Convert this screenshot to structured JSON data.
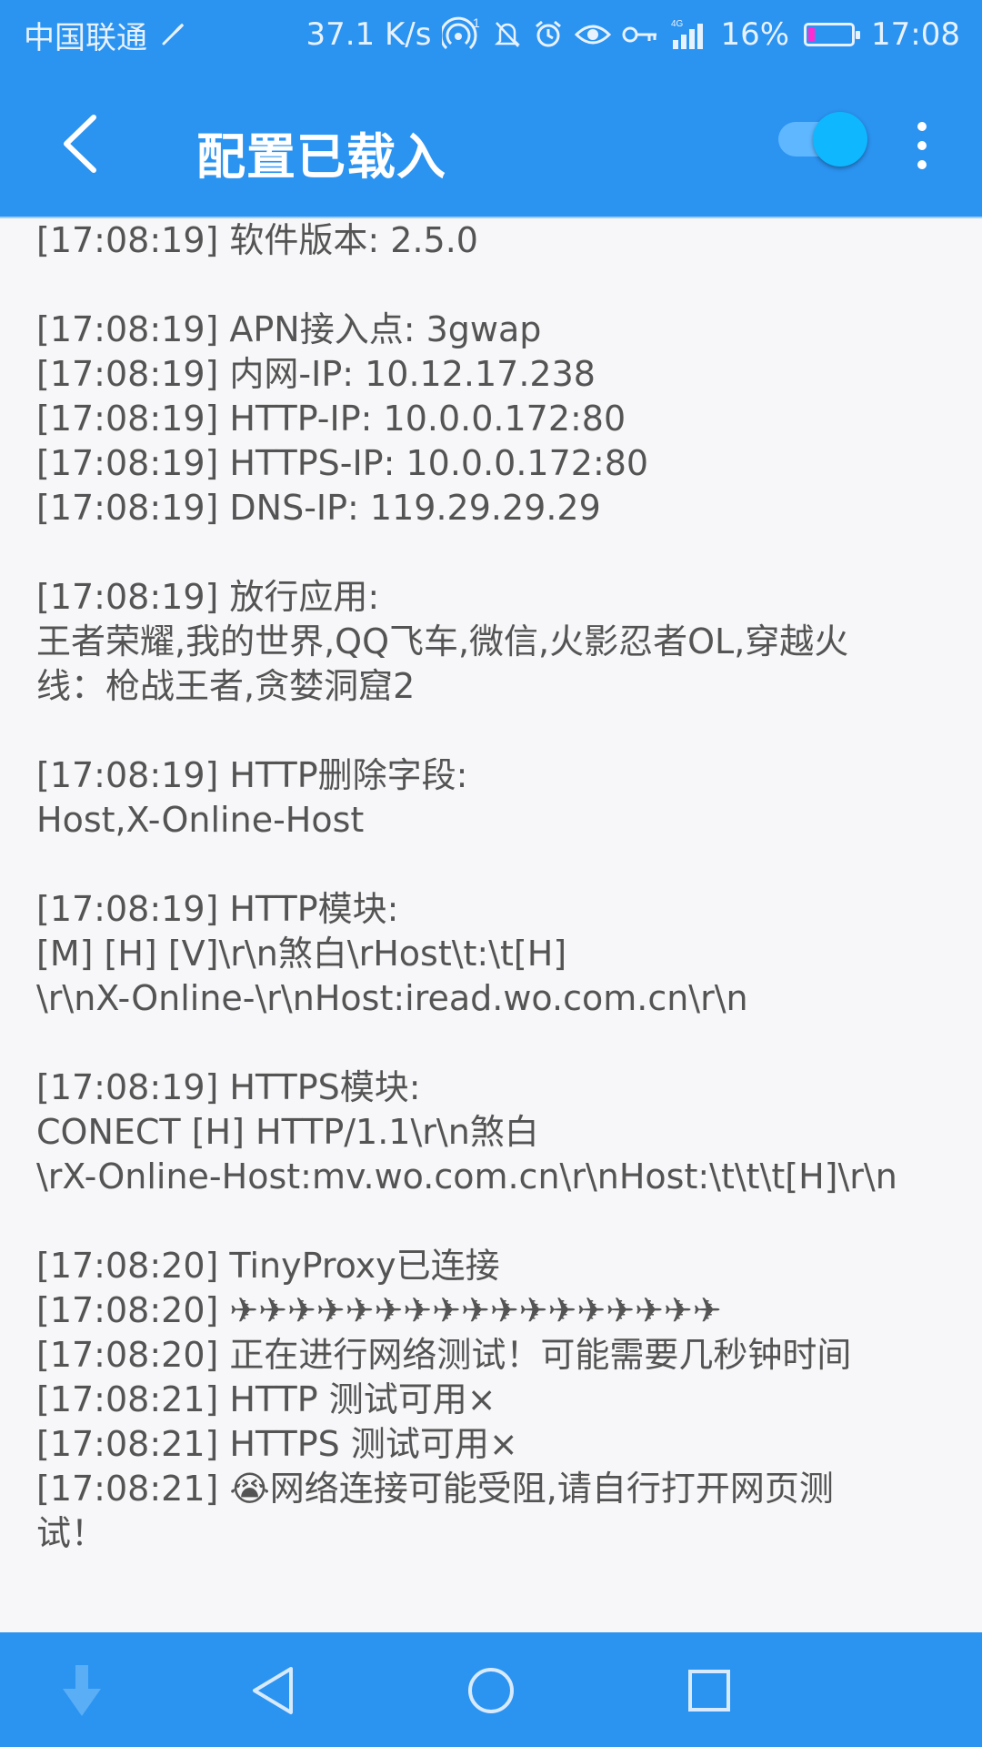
{
  "status_bar": {
    "carrier": "中国联通",
    "speed": "37.1 K/s",
    "hotspot_count": "1",
    "network_type": "4G",
    "battery_percent": "16%",
    "battery_level": 0.16,
    "time": "17:08",
    "icons": [
      "rocket-icon",
      "hotspot-icon",
      "mute-bell-icon",
      "alarm-icon",
      "eye-icon",
      "key-icon",
      "signal-icon",
      "battery-icon"
    ]
  },
  "toolbar": {
    "title": "配置已载入",
    "toggle_on": true,
    "back_icon": "back-arrow-icon",
    "menu_icon": "more-vertical-icon"
  },
  "log": {
    "lines": [
      "[17:08:19] 软件版本: 2.5.0",
      "",
      "[17:08:19] APN接入点: 3gwap",
      "[17:08:19] 内网-IP: 10.12.17.238",
      "[17:08:19] HTTP-IP: 10.0.0.172:80",
      "[17:08:19] HTTPS-IP: 10.0.0.172:80",
      "[17:08:19] DNS-IP: 119.29.29.29",
      "",
      "[17:08:19] 放行应用:",
      "王者荣耀,我的世界,QQ飞车,微信,火影忍者OL,穿越火",
      "线：枪战王者,贪婪洞窟2",
      "",
      "[17:08:19] HTTP删除字段:",
      "Host,X-Online-Host",
      "",
      "[17:08:19] HTTP模块:",
      "[M] [H] [V]\\r\\n煞白\\rHost\\t:\\t[H]",
      "\\r\\nX-Online-\\r\\nHost:iread.wo.com.cn\\r\\n",
      "",
      "[17:08:19] HTTPS模块:",
      "CONECT [H] HTTP/1.1\\r\\n煞白",
      "\\rX-Online-Host:mv.wo.com.cn\\r\\nHost:\\t\\t\\t[H]\\r\\n",
      "",
      "[17:08:20] TinyProxy已连接",
      "[17:08:20] ✈✈✈✈✈✈✈✈✈✈✈✈✈✈✈✈✈",
      "[17:08:20] 正在进行网络测试！可能需要几秒钟时间",
      "[17:08:21] HTTP 测试可用×",
      "[17:08:21] HTTPS 测试可用×",
      "[17:08:21] 😭网络连接可能受阻,请自行打开网页测",
      "试！"
    ]
  },
  "nav_bar": {
    "icons": [
      "scroll-down-icon",
      "nav-back-icon",
      "nav-home-icon",
      "nav-recent-icon"
    ]
  },
  "colors": {
    "primary": "#2b93f0",
    "text": "#545454",
    "background": "#f7f7f9",
    "toggle": "#0fb7ff"
  }
}
